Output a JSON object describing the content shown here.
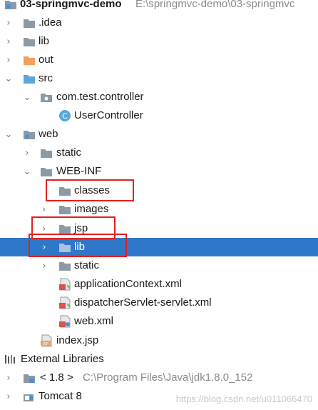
{
  "project": {
    "name": "03-springmvc-demo",
    "path": "E:\\springmvc-demo\\03-springmvc"
  },
  "tree": {
    "idea": ".idea",
    "lib": "lib",
    "out": "out",
    "src": "src",
    "package": "com.test.controller",
    "controller": "UserController",
    "web": "web",
    "static1": "static",
    "webinf": "WEB-INF",
    "classes": "classes",
    "images": "images",
    "jsp": "jsp",
    "lib2": "lib",
    "static2": "static",
    "appctx": "applicationContext.xml",
    "dispatcher": "dispatcher­Servlet-servlet.xml",
    "webxml": "web.xml",
    "index": "index.jsp"
  },
  "external": {
    "label": "External Libraries",
    "jdk": "< 1.8 >",
    "jdk_path": "C:\\Program Files\\Java\\jdk1.8.0_152",
    "tomcat": "Tomcat 8"
  },
  "watermark": "https://blog.csdn.net/u011066470",
  "colors": {
    "selection": "#2f77c9",
    "folder": "#8c9aa6",
    "out_folder": "#f0a15c",
    "src_folder": "#5aa7d8",
    "highlight_box": "#e02020"
  }
}
